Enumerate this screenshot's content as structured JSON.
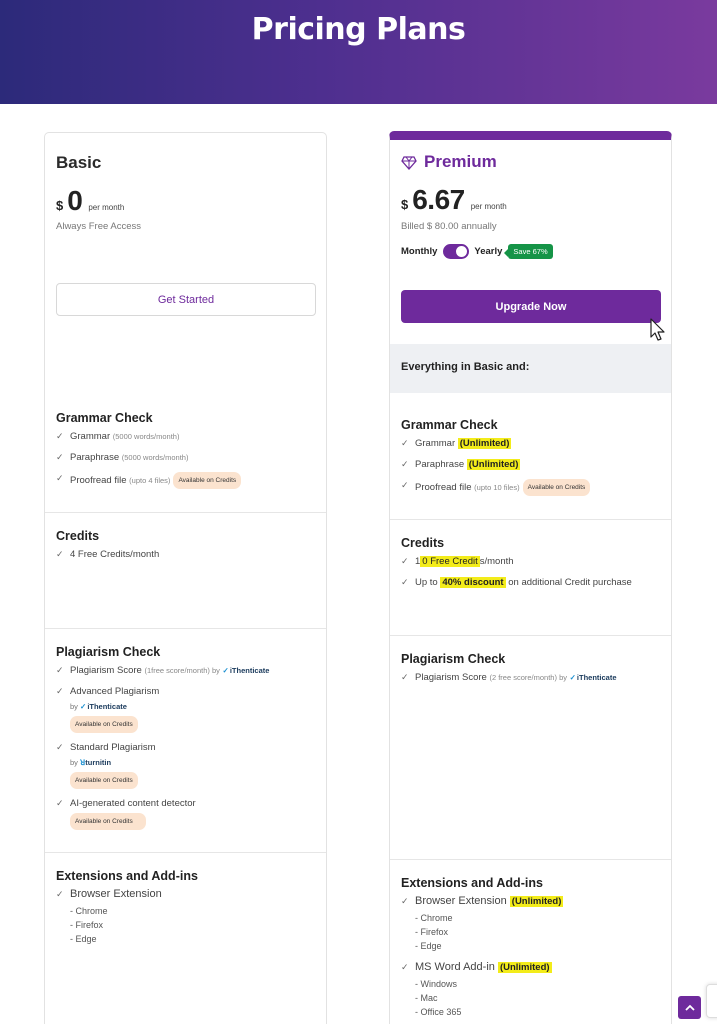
{
  "header": {
    "title": "Pricing Plans"
  },
  "colors": {
    "brand": "#6e2a9c",
    "highlight": "#f3ec1a",
    "save_badge": "#159447",
    "credit_pill": "#fbe3cf"
  },
  "basic": {
    "name": "Basic",
    "currency": "$",
    "price": "0",
    "period": "per month",
    "note": "Always Free Access",
    "cta": "Get Started",
    "grammar": {
      "title": "Grammar Check",
      "items": [
        {
          "label": "Grammar",
          "detail": "(5000 words/month)"
        },
        {
          "label": "Paraphrase",
          "detail": "(5000 words/month)"
        },
        {
          "label": "Proofread file",
          "detail": "(upto 4 files)",
          "pill": "Available on Credits"
        }
      ]
    },
    "credits": {
      "title": "Credits",
      "items": [
        "4 Free Credits/month"
      ]
    },
    "plagiarism": {
      "title": "Plagiarism Check",
      "score_label": "Plagiarism Score",
      "score_detail": "(1free score/month) by",
      "ithenticate": "iThenticate",
      "advanced": "Advanced Plagiarism",
      "by": "by",
      "turnitin": "turnitin",
      "standard": "Standard Plagiarism",
      "ai": "AI-generated content detector",
      "pill": "Available on Credits"
    },
    "extensions": {
      "title": "Extensions and Add-ins",
      "browser": "Browser Extension",
      "browsers": [
        "- Chrome",
        "- Firefox",
        "- Edge"
      ]
    }
  },
  "premium": {
    "name": "Premium",
    "currency": "$",
    "price": "6.67",
    "period": "per month",
    "billed": "Billed $ 80.00 annually",
    "monthly": "Monthly",
    "yearly": "Yearly",
    "save": "Save 67%",
    "billing_toggle": "yearly",
    "cta": "Upgrade Now",
    "everything": "Everything in Basic and:",
    "grammar": {
      "title": "Grammar Check",
      "grammar": "Grammar",
      "paraphrase": "Paraphrase",
      "unlimited": "(Unlimited)",
      "proofread": "Proofread file",
      "proofread_detail": "(upto 10 files)",
      "pill": "Available on Credits"
    },
    "credits": {
      "title": "Credits",
      "c1_pre": "1",
      "c1_hl": "0 Free Credit",
      "c1_post": "s/month",
      "c2_pre": "Up to",
      "c2_hl": "40% discount",
      "c2_post": "on additional Credit purchase"
    },
    "plagiarism": {
      "title": "Plagiarism Check",
      "score_label": "Plagiarism Score",
      "score_detail": "(2 free score/month) by",
      "ithenticate": "iThenticate"
    },
    "extensions": {
      "title": "Extensions and Add-ins",
      "browser": "Browser Extension",
      "unlimited": "(Unlimited)",
      "browsers": [
        "- Chrome",
        "- Firefox",
        "- Edge"
      ],
      "word": "MS Word Add-in",
      "platforms": [
        "- Windows",
        "- Mac",
        "- Office 365"
      ]
    }
  }
}
